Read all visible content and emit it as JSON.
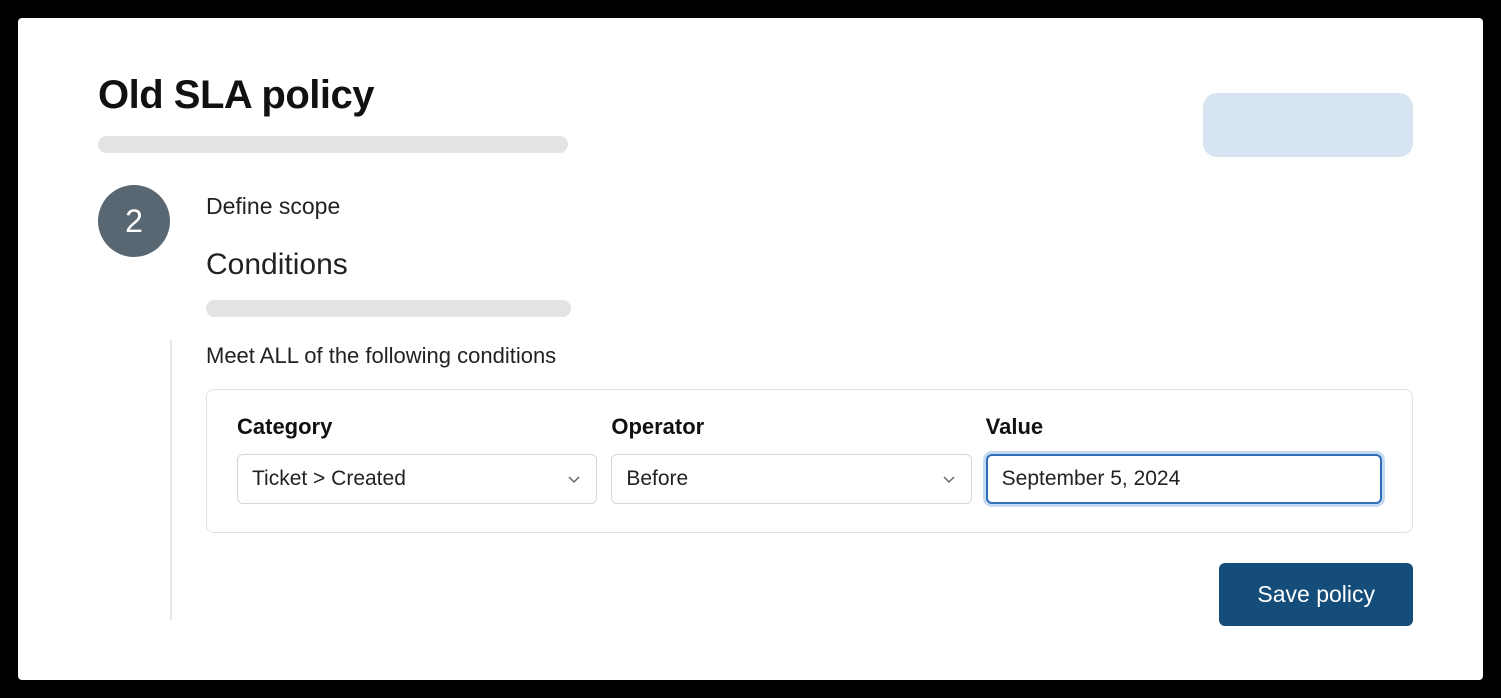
{
  "header": {
    "title": "Old SLA policy"
  },
  "step": {
    "number": "2",
    "label": "Define scope"
  },
  "conditions": {
    "title": "Conditions",
    "intro": "Meet ALL of the following conditions",
    "columns": {
      "category_label": "Category",
      "operator_label": "Operator",
      "value_label": "Value"
    },
    "row": {
      "category": "Ticket > Created",
      "operator": "Before",
      "value": "September 5, 2024"
    }
  },
  "actions": {
    "save_label": "Save policy"
  }
}
